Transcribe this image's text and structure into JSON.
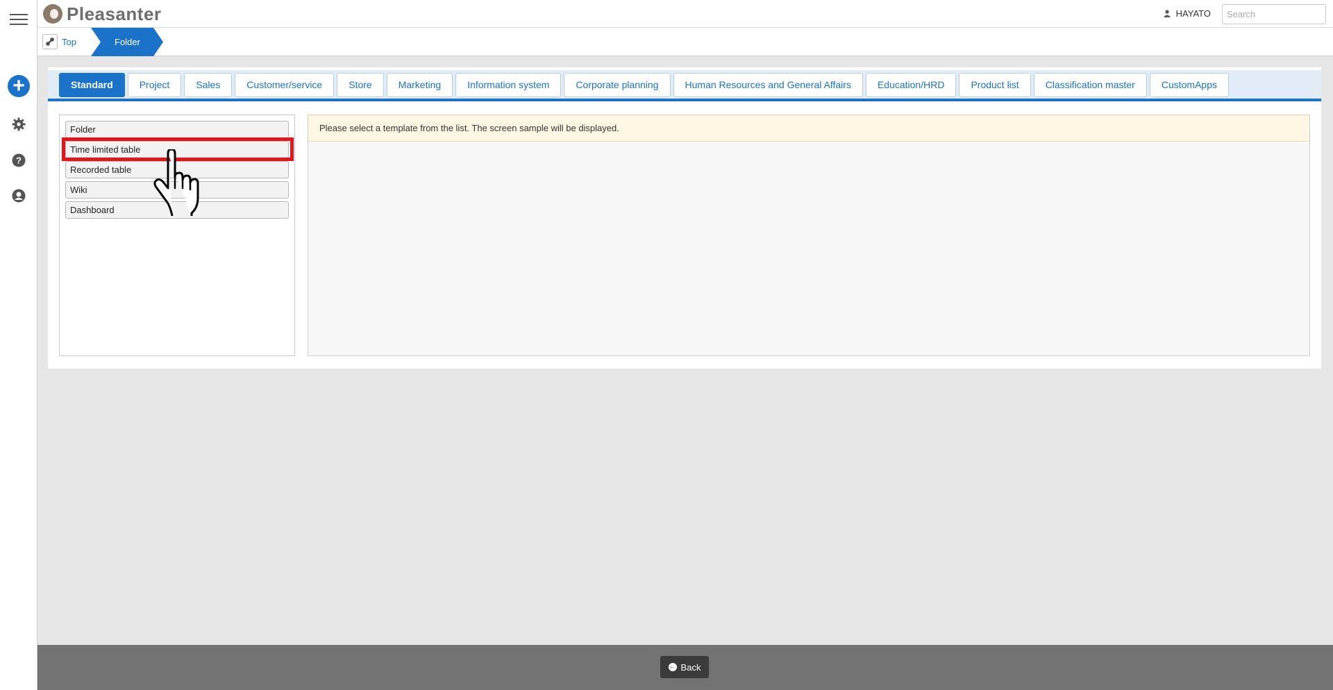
{
  "app": {
    "logo_text": "Pleasanter"
  },
  "rail": {
    "icons": [
      "hamburger-menu-icon",
      "plus-icon",
      "gear-icon",
      "help-icon",
      "user-icon"
    ]
  },
  "header": {
    "user_name": "HAYATO",
    "search_placeholder": "Search"
  },
  "breadcrumb": {
    "top_label": "Top",
    "current_label": "Folder"
  },
  "tabs": [
    {
      "label": "Standard",
      "active": true
    },
    {
      "label": "Project"
    },
    {
      "label": "Sales"
    },
    {
      "label": "Customer/service"
    },
    {
      "label": "Store"
    },
    {
      "label": "Marketing"
    },
    {
      "label": "Information system"
    },
    {
      "label": "Corporate planning"
    },
    {
      "label": "Human Resources and General Affairs"
    },
    {
      "label": "Education/HRD"
    },
    {
      "label": "Product list"
    },
    {
      "label": "Classification master"
    },
    {
      "label": "CustomApps"
    }
  ],
  "templates": [
    {
      "label": "Folder"
    },
    {
      "label": "Time limited table",
      "highlighted": true
    },
    {
      "label": "Recorded table"
    },
    {
      "label": "Wiki"
    },
    {
      "label": "Dashboard"
    }
  ],
  "preview": {
    "notice": "Please select a template from the list. The screen sample will be displayed."
  },
  "footer": {
    "back_label": "Back"
  },
  "colors": {
    "accent": "#1a73c8",
    "highlight": "#e8141b",
    "footer": "#737373"
  }
}
